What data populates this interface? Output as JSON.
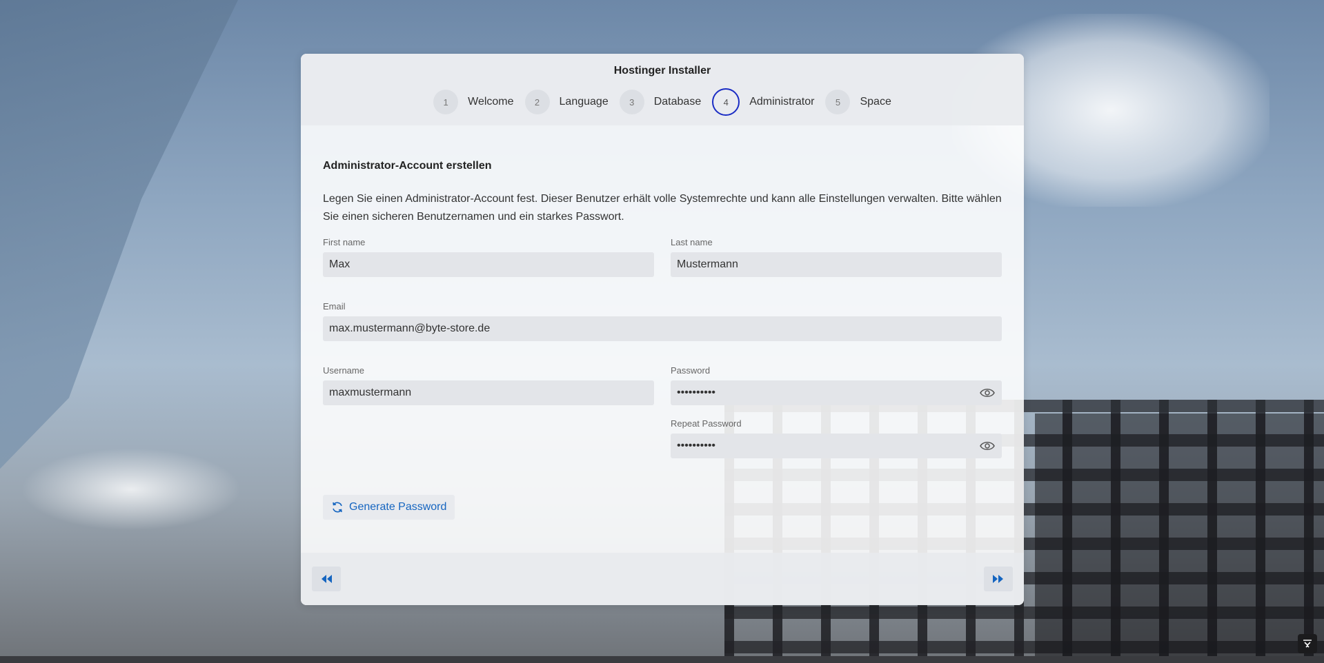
{
  "installer": {
    "title": "Hostinger Installer",
    "steps": [
      {
        "num": "1",
        "label": "Welcome"
      },
      {
        "num": "2",
        "label": "Language"
      },
      {
        "num": "3",
        "label": "Database"
      },
      {
        "num": "4",
        "label": "Administrator",
        "active": true
      },
      {
        "num": "5",
        "label": "Space"
      }
    ]
  },
  "form": {
    "section_title": "Administrator-Account erstellen",
    "intro": "Legen Sie einen Administrator-Account fest. Dieser Benutzer erhält volle Systemrechte und kann alle Einstellungen verwalten. Bitte wählen Sie einen sicheren Benutzernamen und ein starkes Passwort.",
    "first_name": {
      "label": "First name",
      "value": "Max"
    },
    "last_name": {
      "label": "Last name",
      "value": "Mustermann"
    },
    "email": {
      "label": "Email",
      "value": "max.mustermann@byte-store.de"
    },
    "username": {
      "label": "Username",
      "value": "maxmustermann"
    },
    "password": {
      "label": "Password",
      "value": "••••••••••"
    },
    "repeat_password": {
      "label": "Repeat Password",
      "value": "••••••••••"
    },
    "generate_label": "Generate Password"
  },
  "icons": {
    "generate": "refresh-icon",
    "show_password": "eye-icon",
    "back": "double-chevron-left-icon",
    "next": "double-chevron-right-icon",
    "corner": "collapse-icon"
  },
  "colors": {
    "accent": "#1565c0",
    "active_step_ring": "#1a2cc4"
  }
}
